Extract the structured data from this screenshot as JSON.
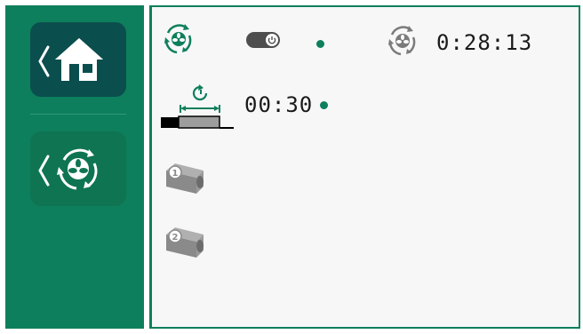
{
  "colors": {
    "sidebar_green": "#0e7f5c",
    "active_nav": "#0b4e4e",
    "text": "#1a1a1a",
    "icon_gray": "#7b7b7b"
  },
  "sidebar": {
    "items": [
      {
        "name": "home",
        "icon": "home-icon",
        "active": true
      },
      {
        "name": "ventilation",
        "icon": "fan-cycle-icon",
        "active": false
      }
    ]
  },
  "status": {
    "fan_mode_icon": "fan-cycle-icon",
    "power_toggle_on": true,
    "fan_timer_icon": "fan-timer-icon",
    "fan_timer_value": "0:28:13",
    "schedule_icon": "schedule-icon",
    "schedule_value": "00:30"
  },
  "units": [
    {
      "icon": "unit-1-icon"
    },
    {
      "icon": "unit-2-icon"
    }
  ]
}
